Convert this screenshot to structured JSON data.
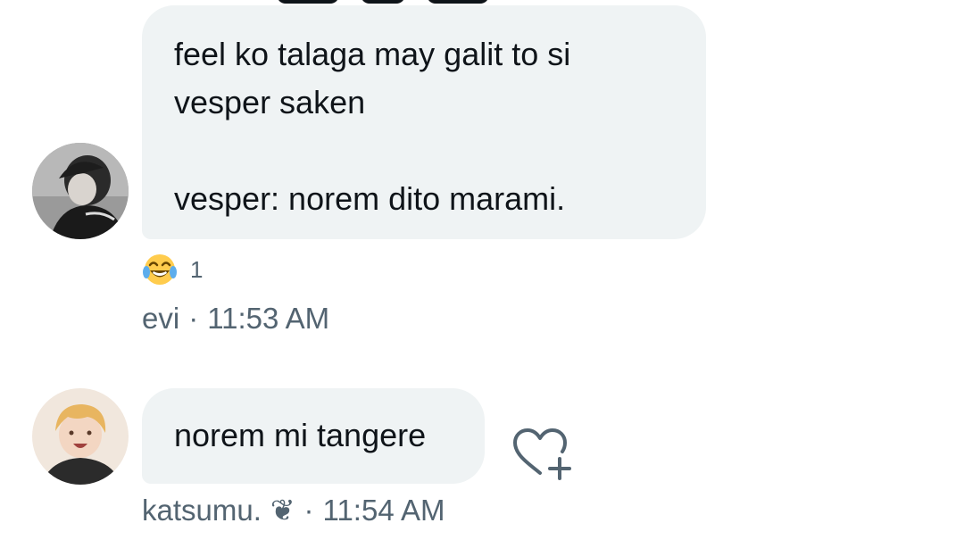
{
  "conversation": {
    "messages": [
      {
        "text": "feel ko talaga may galit to si\nvesper saken\n\nvesper: norem dito marami.",
        "reaction": {
          "emoji": "😂",
          "count": "1"
        },
        "sender": "evi",
        "separator": "·",
        "time": "11:53 AM"
      },
      {
        "text": "norem mi tangere",
        "sender": "katsumu.",
        "sender_badge": "❦",
        "separator": "·",
        "time": "11:54 AM"
      }
    ]
  },
  "icons": {
    "reaction_emoji": "face-with-tears-of-joy",
    "add_reaction": "heart-plus-icon"
  },
  "colors": {
    "bubble": "#eff3f4",
    "text": "#0f1419",
    "meta_text": "#536471"
  }
}
